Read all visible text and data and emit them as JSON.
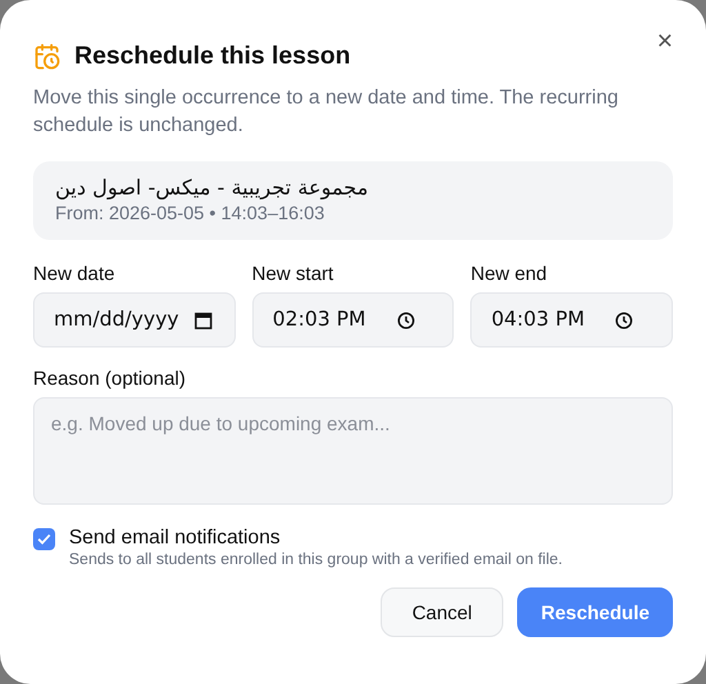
{
  "dialog": {
    "title": "Reschedule this lesson",
    "description": "Move this single occurrence to a new date and time. The recurring schedule is unchanged.",
    "close": "×"
  },
  "lesson": {
    "name": "مجموعة تجريبية - ميكس- اصول دين",
    "from": "From: 2026-05-05 • 14:03–16:03"
  },
  "fields": [
    {
      "kind": "date",
      "label": "New date",
      "placeholder": "mm/dd/yyyy"
    },
    {
      "kind": "time",
      "label": "New start",
      "value": "02:03 PM"
    },
    {
      "kind": "time",
      "label": "New end",
      "value": "04:03 PM"
    }
  ],
  "reason": {
    "label": "Reason (optional)",
    "placeholder": "e.g. Moved up due to upcoming exam..."
  },
  "notify": {
    "label": "Send email notifications",
    "hint": "Sends to all students enrolled in this group with a verified email on file.",
    "checked": true
  },
  "buttons": [
    {
      "kind": "secondary",
      "label": "Cancel"
    },
    {
      "kind": "primary",
      "label": "Reschedule"
    }
  ]
}
